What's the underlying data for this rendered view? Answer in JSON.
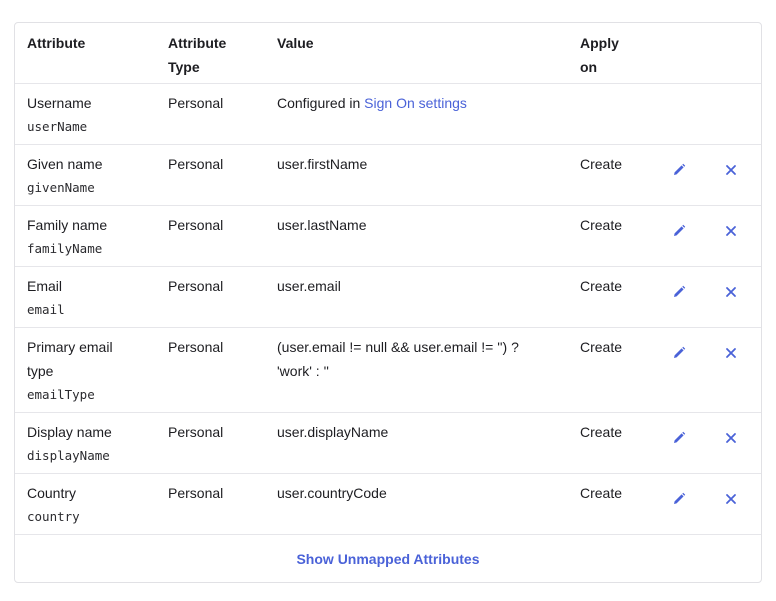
{
  "table": {
    "headers": {
      "attribute": "Attribute",
      "attribute_type_line1": "Attribute",
      "attribute_type_line2": "Type",
      "value": "Value",
      "apply_line1": "Apply",
      "apply_line2": "on"
    },
    "rows": [
      {
        "name_lines": [
          "Username"
        ],
        "key": "userName",
        "type": "Personal",
        "value_prefix": "Configured in ",
        "value_link": "Sign On settings",
        "apply": "",
        "editable": false
      },
      {
        "name_lines": [
          "Given name"
        ],
        "key": "givenName",
        "type": "Personal",
        "value_lines": [
          "user.firstName"
        ],
        "apply": "Create",
        "editable": true
      },
      {
        "name_lines": [
          "Family name"
        ],
        "key": "familyName",
        "type": "Personal",
        "value_lines": [
          "user.lastName"
        ],
        "apply": "Create",
        "editable": true
      },
      {
        "name_lines": [
          "Email"
        ],
        "key": "email",
        "type": "Personal",
        "value_lines": [
          "user.email"
        ],
        "apply": "Create",
        "editable": true
      },
      {
        "name_lines": [
          "Primary email",
          "type"
        ],
        "key": "emailType",
        "type": "Personal",
        "value_lines": [
          "(user.email != null && user.email != '') ?",
          "'work' : ''"
        ],
        "apply": "Create",
        "editable": true
      },
      {
        "name_lines": [
          "Display name"
        ],
        "key": "displayName",
        "type": "Personal",
        "value_lines": [
          "user.displayName"
        ],
        "apply": "Create",
        "editable": true
      },
      {
        "name_lines": [
          "Country"
        ],
        "key": "country",
        "type": "Personal",
        "value_lines": [
          "user.countryCode"
        ],
        "apply": "Create",
        "editable": true
      }
    ],
    "icons": {
      "edit": "pencil-icon",
      "delete": "close-icon"
    },
    "footer_button": "Show Unmapped Attributes"
  },
  "colors": {
    "accent": "#4a62d8",
    "border": "#e1e1e5",
    "text": "#1d1d21"
  }
}
